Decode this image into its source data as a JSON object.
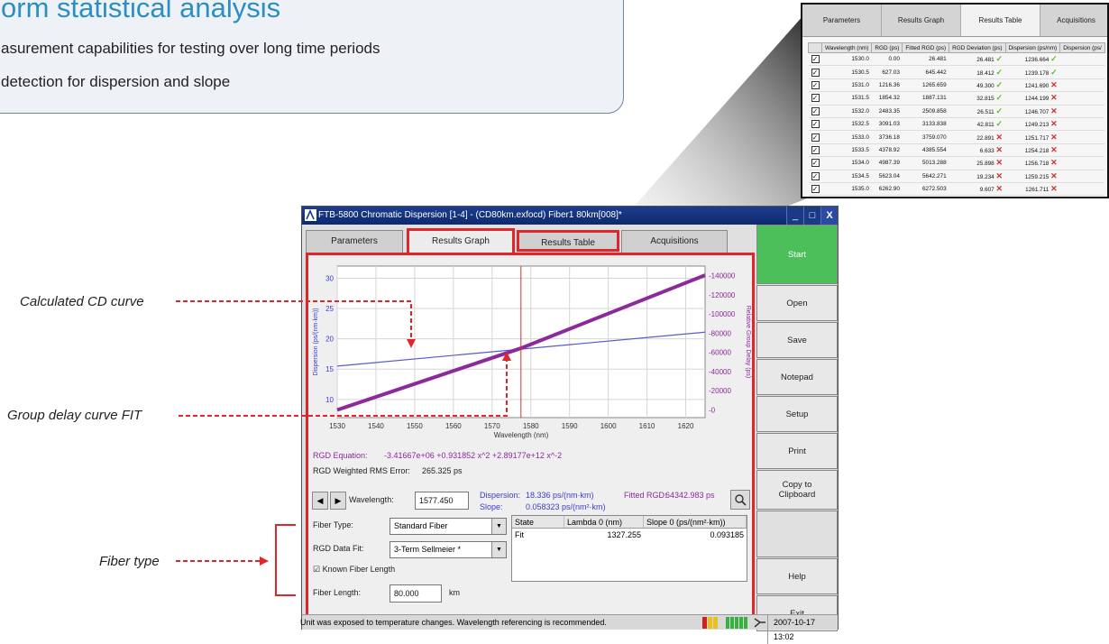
{
  "marketing": {
    "title": "orm statistical analysis",
    "line1": "asurement capabilities for testing over long time periods",
    "line2": "detection for dispersion and slope"
  },
  "inset": {
    "tabs": [
      "Parameters",
      "Results Graph",
      "Results Table",
      "Acquisitions"
    ],
    "columns": [
      "Wavelength (nm)",
      "RGD (ps)",
      "Fitted RGD (ps)",
      "RGD Deviation (ps)",
      "Dispersion (ps/nm)",
      "Dispersion (ps/"
    ],
    "rows": [
      {
        "wl": "1530.0",
        "rgd": "0.00",
        "fit": "26.481",
        "dev": "26.481",
        "dev_ok": true,
        "disp": "1236.664",
        "disp_ok": true
      },
      {
        "wl": "1530.5",
        "rgd": "627.03",
        "fit": "645.442",
        "dev": "18.412",
        "dev_ok": true,
        "disp": "1239.178",
        "disp_ok": true
      },
      {
        "wl": "1531.0",
        "rgd": "1216.36",
        "fit": "1265.659",
        "dev": "49.300",
        "dev_ok": true,
        "disp": "1241.690",
        "disp_ok": false
      },
      {
        "wl": "1531.5",
        "rgd": "1854.32",
        "fit": "1887.131",
        "dev": "32.815",
        "dev_ok": true,
        "disp": "1244.199",
        "disp_ok": false
      },
      {
        "wl": "1532.0",
        "rgd": "2483.35",
        "fit": "2509.858",
        "dev": "26.511",
        "dev_ok": true,
        "disp": "1246.707",
        "disp_ok": false
      },
      {
        "wl": "1532.5",
        "rgd": "3091.03",
        "fit": "3133.838",
        "dev": "42.811",
        "dev_ok": true,
        "disp": "1249.213",
        "disp_ok": false
      },
      {
        "wl": "1533.0",
        "rgd": "3736.18",
        "fit": "3759.070",
        "dev": "22.891",
        "dev_ok": false,
        "disp": "1251.717",
        "disp_ok": false
      },
      {
        "wl": "1533.5",
        "rgd": "4378.92",
        "fit": "4385.554",
        "dev": "6.633",
        "dev_ok": false,
        "disp": "1254.218",
        "disp_ok": false
      },
      {
        "wl": "1534.0",
        "rgd": "4987.39",
        "fit": "5013.288",
        "dev": "25.898",
        "dev_ok": false,
        "disp": "1256.718",
        "disp_ok": false
      },
      {
        "wl": "1534.5",
        "rgd": "5623.04",
        "fit": "5642.271",
        "dev": "19.234",
        "dev_ok": false,
        "disp": "1259.215",
        "disp_ok": false
      },
      {
        "wl": "1535.0",
        "rgd": "6262.90",
        "fit": "6272.503",
        "dev": "9.607",
        "dev_ok": false,
        "disp": "1261.711",
        "disp_ok": false
      }
    ]
  },
  "window": {
    "title": "FTB-5800 Chromatic Dispersion  [1-4] - (CD80km.exfocd) Fiber1 80km[008]*",
    "min_glyph": "_",
    "max_glyph": "□",
    "close_glyph": "X",
    "tabs": {
      "parameters": "Parameters",
      "results_graph": "Results Graph",
      "results_table": "Results Table",
      "acquisitions": "Acquisitions"
    }
  },
  "chart_data": {
    "type": "line",
    "xlabel": "Wavelength (nm)",
    "ylabel_left": "Dispersion (ps/(nm·km))",
    "ylabel_right": "Relative Group Delay (ps)",
    "xlim": [
      1530,
      1625
    ],
    "ylim_left": [
      7,
      32
    ],
    "ylim_right": [
      -8000,
      150000
    ],
    "x_ticks": [
      1530,
      1540,
      1550,
      1560,
      1570,
      1580,
      1590,
      1600,
      1610,
      1620
    ],
    "y_left_ticks": [
      10,
      15,
      20,
      25,
      30
    ],
    "y_right_ticks": [
      0,
      20000,
      40000,
      60000,
      80000,
      100000,
      120000,
      140000
    ],
    "marker_x": 1577.45,
    "series": [
      {
        "axis": "left",
        "color": "#5a5ac8",
        "x": [
          1530,
          1625
        ],
        "y": [
          15.5,
          21.1
        ]
      },
      {
        "axis": "right",
        "color": "#8c2a9b",
        "x": [
          1530,
          1577.45,
          1625
        ],
        "y": [
          0,
          64342.983,
          140500
        ]
      }
    ]
  },
  "results": {
    "rgd_equation_label": "RGD Equation:",
    "rgd_equation": "-3.41667e+06 +0.931852 x^2 +2.89177e+12 x^-2",
    "rms_label": "RGD Weighted RMS Error:",
    "rms_value": "265.325 ps",
    "wavelength_label": "Wavelength:",
    "wavelength_value": "1577.450",
    "dispersion_label": "Dispersion:",
    "dispersion_value": "18.336 ps/(nm·km)",
    "slope_label": "Slope:",
    "slope_value": "0.058323 ps/(nm²·km)",
    "fitted_rgd_label": "Fitted RGD:",
    "fitted_rgd_value": "64342.983 ps",
    "prev_glyph": "◀",
    "next_glyph": "▶"
  },
  "settings": {
    "fiber_type_label": "Fiber Type:",
    "fiber_type_value": "Standard Fiber",
    "rgd_fit_label": "RGD Data Fit:",
    "rgd_fit_value": "3-Term Sellmeier *",
    "known_length_label": "Known Fiber Length",
    "known_length_checked": "☑",
    "fiber_length_label": "Fiber Length:",
    "fiber_length_value": "80.000",
    "fiber_length_unit": "km"
  },
  "fit_table": {
    "headers": [
      "State",
      "Lambda 0 (nm)",
      "Slope 0 (ps/(nm²·km))"
    ],
    "rows": [
      [
        "Fit",
        "1327.255",
        "0.093185"
      ]
    ]
  },
  "sidebar": {
    "start": "Start",
    "open": "Open",
    "save": "Save",
    "notepad": "Notepad",
    "setup": "Setup",
    "print": "Print",
    "copy": "Copy to Clipboard",
    "help": "Help",
    "exit": "Exit"
  },
  "status": {
    "message": "Unit was exposed to temperature changes. Wavelength referencing is recommended.",
    "datetime": "2007-10-17 13:02"
  },
  "callouts": {
    "cd_curve": "Calculated CD curve",
    "gd_curve": "Group delay curve FIT",
    "fiber_type": "Fiber type"
  },
  "colors": {
    "accent_red": "#e0262b",
    "start_green": "#4cbf5a",
    "title_blue": "#2a8fc3"
  }
}
